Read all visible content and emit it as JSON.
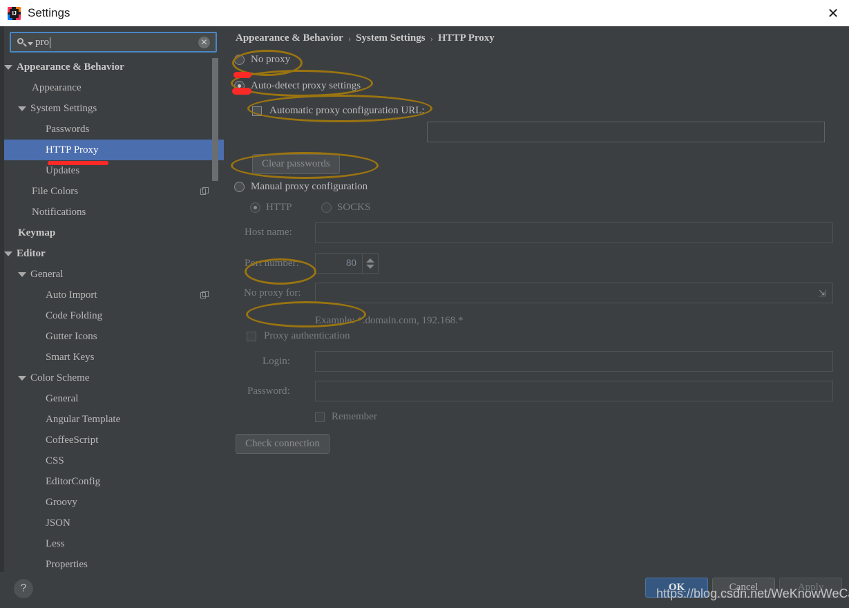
{
  "window": {
    "title": "Settings",
    "logo_icon": "intellij-idea-logo",
    "close_icon": "close-icon"
  },
  "search": {
    "value": "pro",
    "placeholder": "",
    "search_icon": "search-icon",
    "dropdown_icon": "chevron-down-icon",
    "clear_icon": "clear-icon"
  },
  "sidebar": {
    "items": [
      {
        "label": "Appearance & Behavior",
        "indent": 0,
        "arrow": true,
        "bold": true,
        "selected": false,
        "copy": false
      },
      {
        "label": "Appearance",
        "indent": 1,
        "arrow": false,
        "bold": false,
        "selected": false,
        "copy": false
      },
      {
        "label": "System Settings",
        "indent": 1,
        "arrow": true,
        "bold": false,
        "selected": false,
        "copy": false
      },
      {
        "label": "Passwords",
        "indent": 2,
        "arrow": false,
        "bold": false,
        "selected": false,
        "copy": false
      },
      {
        "label": "HTTP Proxy",
        "indent": 2,
        "arrow": false,
        "bold": false,
        "selected": true,
        "copy": false
      },
      {
        "label": "Updates",
        "indent": 2,
        "arrow": false,
        "bold": false,
        "selected": false,
        "copy": false
      },
      {
        "label": "File Colors",
        "indent": 1,
        "arrow": false,
        "bold": false,
        "selected": false,
        "copy": true
      },
      {
        "label": "Notifications",
        "indent": 1,
        "arrow": false,
        "bold": false,
        "selected": false,
        "copy": false
      },
      {
        "label": "Keymap",
        "indent": 0,
        "arrow": false,
        "bold": true,
        "selected": false,
        "copy": false
      },
      {
        "label": "Editor",
        "indent": 0,
        "arrow": true,
        "bold": true,
        "selected": false,
        "copy": false
      },
      {
        "label": "General",
        "indent": 1,
        "arrow": true,
        "bold": false,
        "selected": false,
        "copy": false
      },
      {
        "label": "Auto Import",
        "indent": 2,
        "arrow": false,
        "bold": false,
        "selected": false,
        "copy": true
      },
      {
        "label": "Code Folding",
        "indent": 2,
        "arrow": false,
        "bold": false,
        "selected": false,
        "copy": false
      },
      {
        "label": "Gutter Icons",
        "indent": 2,
        "arrow": false,
        "bold": false,
        "selected": false,
        "copy": false
      },
      {
        "label": "Smart Keys",
        "indent": 2,
        "arrow": false,
        "bold": false,
        "selected": false,
        "copy": false
      },
      {
        "label": "Color Scheme",
        "indent": 1,
        "arrow": true,
        "bold": false,
        "selected": false,
        "copy": false
      },
      {
        "label": "General",
        "indent": 2,
        "arrow": false,
        "bold": false,
        "selected": false,
        "copy": false
      },
      {
        "label": "Angular Template",
        "indent": 2,
        "arrow": false,
        "bold": false,
        "selected": false,
        "copy": false
      },
      {
        "label": "CoffeeScript",
        "indent": 2,
        "arrow": false,
        "bold": false,
        "selected": false,
        "copy": false
      },
      {
        "label": "CSS",
        "indent": 2,
        "arrow": false,
        "bold": false,
        "selected": false,
        "copy": false
      },
      {
        "label": "EditorConfig",
        "indent": 2,
        "arrow": false,
        "bold": false,
        "selected": false,
        "copy": false
      },
      {
        "label": "Groovy",
        "indent": 2,
        "arrow": false,
        "bold": false,
        "selected": false,
        "copy": false
      },
      {
        "label": "JSON",
        "indent": 2,
        "arrow": false,
        "bold": false,
        "selected": false,
        "copy": false
      },
      {
        "label": "Less",
        "indent": 2,
        "arrow": false,
        "bold": false,
        "selected": false,
        "copy": false
      },
      {
        "label": "Properties",
        "indent": 2,
        "arrow": false,
        "bold": false,
        "selected": false,
        "copy": false
      }
    ]
  },
  "breadcrumb": {
    "items": [
      "Appearance & Behavior",
      "System Settings",
      "HTTP Proxy"
    ],
    "separator": "›"
  },
  "proxy": {
    "no_proxy_label": "No proxy",
    "no_proxy_selected": false,
    "auto_detect_label": "Auto-detect proxy settings",
    "auto_detect_selected": true,
    "auto_url_label": "Automatic proxy configuration URL:",
    "auto_url_checked": false,
    "auto_url_value": "",
    "clear_passwords_label": "Clear passwords",
    "manual_label": "Manual proxy configuration",
    "manual_selected": false,
    "http_label": "HTTP",
    "http_selected": true,
    "socks_label": "SOCKS",
    "socks_selected": false,
    "host_name_label": "Host name:",
    "host_name_value": "",
    "port_label": "Port number:",
    "port_value": "80",
    "no_proxy_for_label": "No proxy for:",
    "no_proxy_for_value": "",
    "expand_icon": "expand-icon",
    "example_text": "Example: *.domain.com, 192.168.*",
    "proxy_auth_label": "Proxy authentication",
    "proxy_auth_checked": false,
    "login_label": "Login:",
    "login_value": "",
    "password_label": "Password:",
    "password_value": "",
    "remember_label": "Remember",
    "remember_checked": false,
    "check_connection_label": "Check connection"
  },
  "footer": {
    "help_icon": "help-icon",
    "help_label": "?",
    "ok_label": "OK",
    "cancel_label": "Cancel",
    "apply_label": "Apply"
  },
  "watermark": "https://blog.csdn.net/WeKnowWeCan",
  "colors": {
    "accent_blue": "#4b6eaf",
    "ok_button": "#365880",
    "annotation_gold": "#9a7410",
    "annotation_red": "#fb2a26",
    "panel_bg": "#3c3f41",
    "titlebar_bg": "#ffffff"
  }
}
